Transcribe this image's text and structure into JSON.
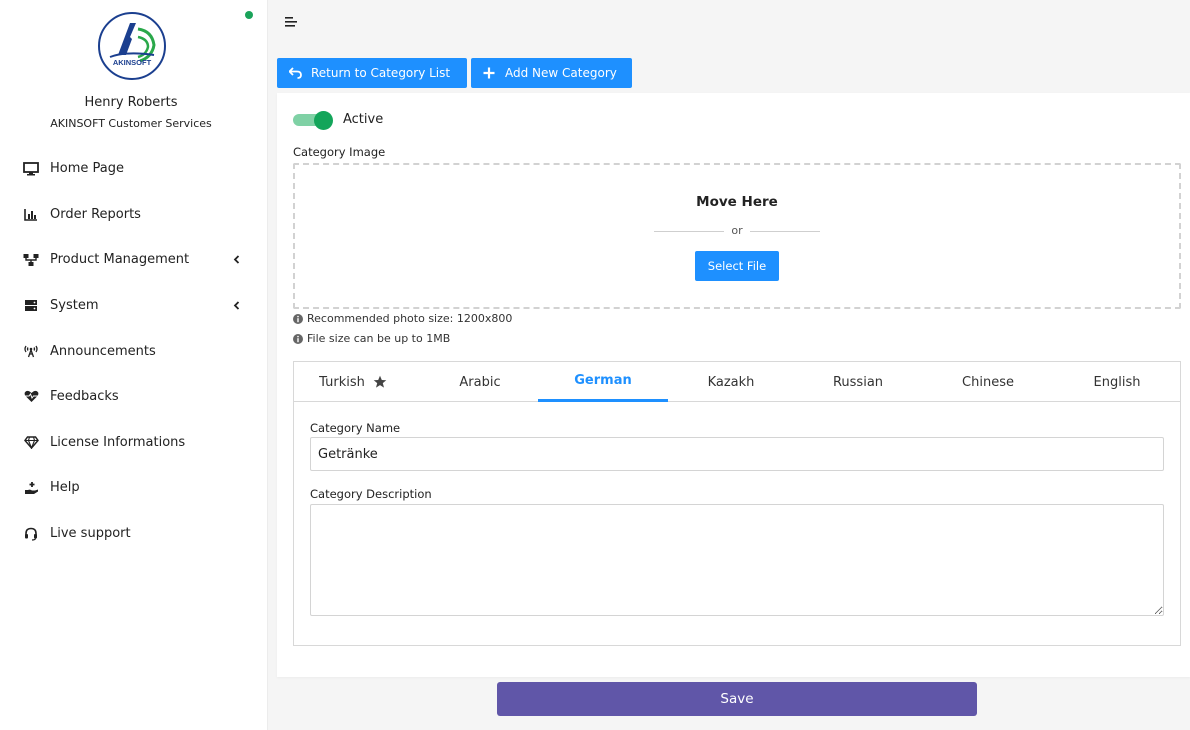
{
  "user": {
    "name": "Henry Roberts",
    "organization": "AKINSOFT Customer Services",
    "logo_text": "AKINSOFT"
  },
  "colors": {
    "primary": "#1e90ff",
    "save": "#6056a8",
    "toggle_on": "#13a55a",
    "online": "#1aa35a"
  },
  "sidebar": {
    "items": [
      {
        "label": "Home Page",
        "icon": "monitor-icon",
        "has_submenu": false
      },
      {
        "label": "Order Reports",
        "icon": "bar-chart-icon",
        "has_submenu": false
      },
      {
        "label": "Product Management",
        "icon": "network-icon",
        "has_submenu": true
      },
      {
        "label": "System",
        "icon": "server-icon",
        "has_submenu": true
      },
      {
        "label": "Announcements",
        "icon": "broadcast-icon",
        "has_submenu": false
      },
      {
        "label": "Feedbacks",
        "icon": "heartbeat-icon",
        "has_submenu": false
      },
      {
        "label": "License Informations",
        "icon": "gem-icon",
        "has_submenu": false
      },
      {
        "label": "Help",
        "icon": "hand-holding-icon",
        "has_submenu": false
      },
      {
        "label": "Live support",
        "icon": "headset-icon",
        "has_submenu": false
      }
    ]
  },
  "toolbar": {
    "return_label": "Return to Category List",
    "add_label": "Add New Category"
  },
  "form": {
    "active_label": "Active",
    "active": true,
    "image_label": "Category Image",
    "drop_title": "Move Here",
    "drop_or": "or",
    "select_file_label": "Select File",
    "hint_size": "Recommended photo size: 1200x800",
    "hint_file": "File size can be up to 1MB",
    "name_label": "Category Name",
    "name_value": "Getränke",
    "description_label": "Category Description",
    "description_value": "",
    "save_label": "Save"
  },
  "tabs": [
    {
      "label": "Turkish",
      "default": true
    },
    {
      "label": "Arabic"
    },
    {
      "label": "German",
      "active": true
    },
    {
      "label": "Kazakh"
    },
    {
      "label": "Russian"
    },
    {
      "label": "Chinese"
    },
    {
      "label": "English"
    }
  ]
}
